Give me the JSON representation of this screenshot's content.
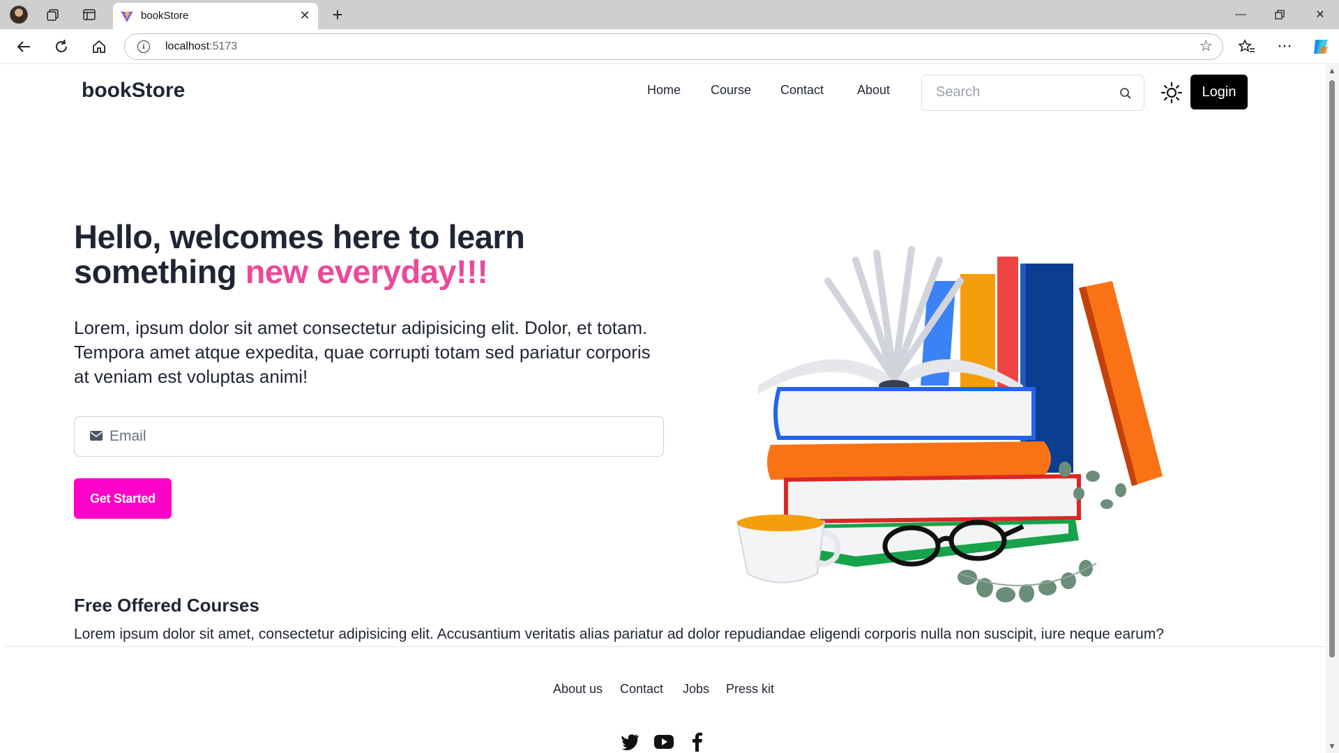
{
  "browser": {
    "tab_title": "bookStore",
    "address_host": "localhost",
    "address_port": ":5173",
    "icons": [
      "profile-avatar",
      "collections-icon",
      "tab-actions-icon",
      "vite-favicon",
      "close-icon",
      "new-tab-icon",
      "minimize-icon",
      "restore-icon",
      "window-close-icon",
      "back-icon",
      "refresh-icon",
      "home-icon",
      "site-info-icon",
      "favorite-star-icon",
      "favorites-icon",
      "more-icon",
      "copilot-icon"
    ]
  },
  "header": {
    "brand": "bookStore",
    "menu": [
      "Home",
      "Course",
      "Contact",
      "About"
    ],
    "search_placeholder": "Search",
    "login_label": "Login"
  },
  "hero": {
    "title_line1": "Hello, welcomes here to learn",
    "title_line2_plain": "something ",
    "title_line2_accent": "new everyday!!!",
    "text": "Lorem, ipsum dolor sit amet consectetur adipisicing elit. Dolor, et totam. Tempora amet atque expedita, quae corrupti totam sed pariatur corporis at veniam est voluptas animi!",
    "email_placeholder": "Email",
    "cta_label": "Get Started"
  },
  "courses": {
    "title": "Free Offered Courses",
    "text": "Lorem ipsum dolor sit amet, consectetur adipisicing elit. Accusantium veritatis alias pariatur ad dolor repudiandae eligendi corporis nulla non suscipit, iure neque earum?"
  },
  "footer": {
    "links": [
      "About us",
      "Contact",
      "Jobs",
      "Press kit"
    ],
    "social": [
      "twitter-icon",
      "youtube-icon",
      "facebook-icon"
    ]
  },
  "colors": {
    "accent": "#ec4899",
    "cta": "#ff00c8",
    "text": "#1f2533",
    "login_bg": "#000000"
  }
}
